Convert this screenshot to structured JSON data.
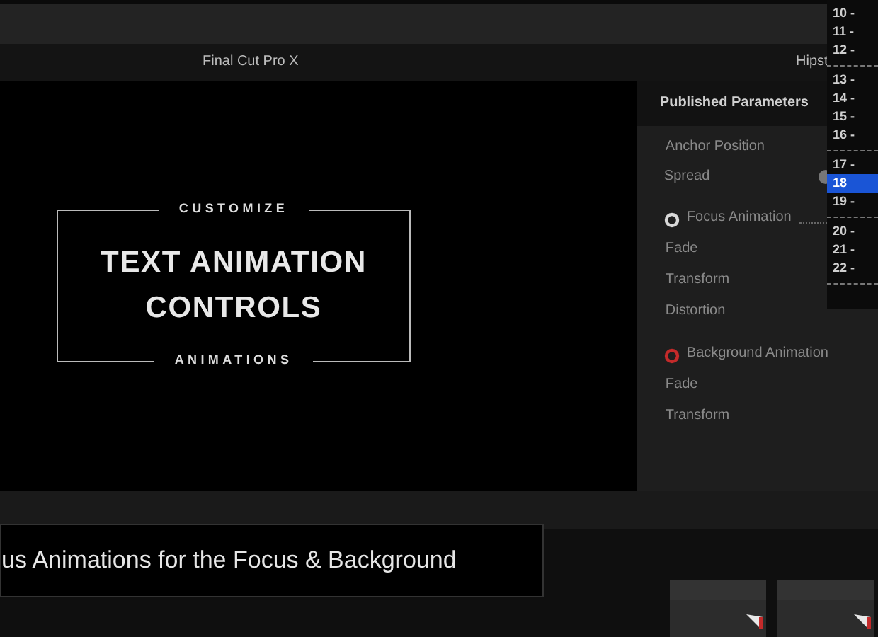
{
  "app_title": "Final Cut Pro X",
  "right_title": "Hipst",
  "viewer": {
    "eyebrow": "CUSTOMIZE",
    "headline_lines": [
      "TEXT ANIMATION",
      "CONTROLS"
    ],
    "footer": "ANIMATIONS"
  },
  "inspector": {
    "header": "Published Parameters",
    "rows": [
      {
        "kind": "param",
        "label": "Anchor Position"
      },
      {
        "kind": "slider",
        "label": "Spread"
      },
      {
        "kind": "section",
        "label": "Focus Animation",
        "color": "#d8d8d8"
      },
      {
        "kind": "param",
        "label": "Fade"
      },
      {
        "kind": "param",
        "label": "Transform"
      },
      {
        "kind": "param",
        "label": "Distortion"
      },
      {
        "kind": "section",
        "label": "Background Animation",
        "color": "#c42a2a"
      },
      {
        "kind": "param",
        "label": "Fade"
      },
      {
        "kind": "param",
        "label": "Transform"
      }
    ]
  },
  "dropdown": [
    {
      "kind": "item",
      "label": "10 -",
      "selected": false
    },
    {
      "kind": "item",
      "label": "11 -",
      "selected": false
    },
    {
      "kind": "item",
      "label": "12 -",
      "selected": false
    },
    {
      "kind": "separator"
    },
    {
      "kind": "item",
      "label": "13 -",
      "selected": false
    },
    {
      "kind": "item",
      "label": "14 -",
      "selected": false
    },
    {
      "kind": "item",
      "label": "15 -",
      "selected": false
    },
    {
      "kind": "item",
      "label": "16 -",
      "selected": false
    },
    {
      "kind": "separator"
    },
    {
      "kind": "item",
      "label": "17 -",
      "selected": false
    },
    {
      "kind": "item",
      "label": "18",
      "selected": true
    },
    {
      "kind": "item",
      "label": "19 -",
      "selected": false
    },
    {
      "kind": "separator"
    },
    {
      "kind": "item",
      "label": "20 -",
      "selected": false
    },
    {
      "kind": "item",
      "label": "21 -",
      "selected": false
    },
    {
      "kind": "item",
      "label": "22 -",
      "selected": false
    },
    {
      "kind": "separator"
    }
  ],
  "caption": "us Animations for the Focus & Background"
}
